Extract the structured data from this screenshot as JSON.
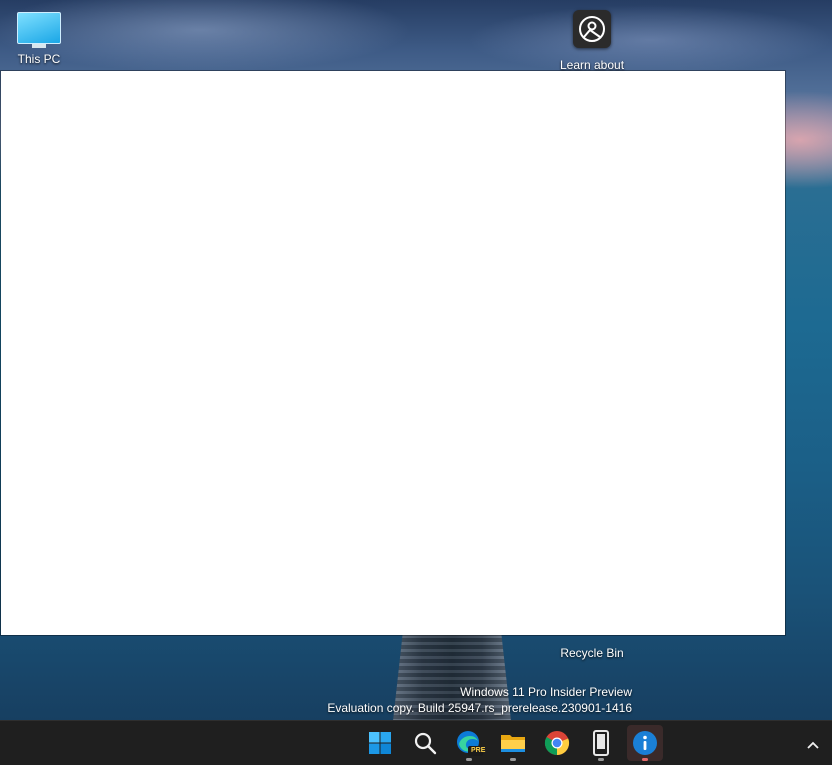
{
  "desktop": {
    "icons": [
      {
        "label": "This PC",
        "icon": "this-pc-icon"
      },
      {
        "label": "Learn about",
        "icon": "learn-about-icon"
      },
      {
        "label": "Recycle Bin",
        "icon": "recycle-bin-icon"
      }
    ],
    "watermark": {
      "line1": "Windows 11 Pro Insider Preview",
      "line2": "Evaluation copy. Build 25947.rs_prerelease.230901-1416"
    }
  },
  "taskbar": {
    "apps": [
      {
        "name": "Start",
        "icon": "windows-start-icon"
      },
      {
        "name": "Search",
        "icon": "search-icon"
      },
      {
        "name": "Microsoft Edge Preview",
        "icon": "edge-preview-icon",
        "badge": "PRE"
      },
      {
        "name": "File Explorer",
        "icon": "file-explorer-icon"
      },
      {
        "name": "Google Chrome",
        "icon": "chrome-icon"
      },
      {
        "name": "Phone Link",
        "icon": "phone-icon"
      },
      {
        "name": "Info",
        "icon": "info-icon",
        "active": true
      }
    ],
    "tray": {
      "icon": "chevron-up-icon"
    }
  },
  "colors": {
    "taskbar_bg": "#1f1f1f",
    "accent": "#1a7fd6",
    "active_indicator": "#e36a6a"
  }
}
